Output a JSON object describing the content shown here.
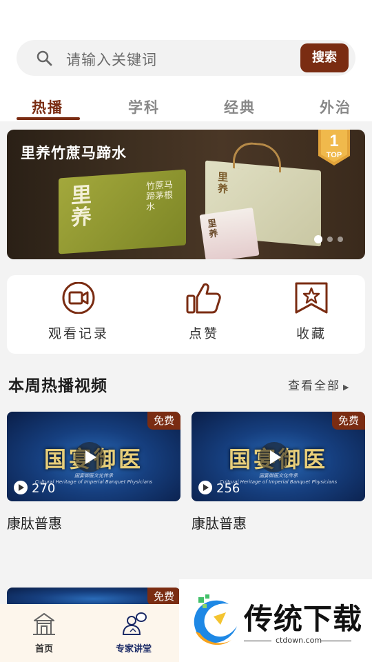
{
  "search": {
    "placeholder": "请输入关键词",
    "button": "搜索"
  },
  "tabs": [
    {
      "label": "热播",
      "active": true
    },
    {
      "label": "学科",
      "active": false
    },
    {
      "label": "经典",
      "active": false
    },
    {
      "label": "外治",
      "active": false
    }
  ],
  "banner": {
    "title": "里养竹蔗马蹄水",
    "box_big": "里养",
    "box_small": "竹蔗马蹄茅根水",
    "bag_label": "里养",
    "pouch_label": "里养",
    "badge_number": "1",
    "badge_text": "TOP",
    "dots": 3,
    "active_dot": 0
  },
  "quick_actions": [
    {
      "label": "观看记录",
      "icon": "video-history-icon"
    },
    {
      "label": "点赞",
      "icon": "thumbs-up-icon"
    },
    {
      "label": "收藏",
      "icon": "bookmark-star-icon"
    }
  ],
  "section": {
    "title": "本周热播视频",
    "more": "查看全部"
  },
  "videos": [
    {
      "thumb_title": "国宴御医",
      "sub1": "国宴御医文化传承",
      "sub2": "Cultural Heritage of Imperial Banquet Physicians",
      "badge": "免费",
      "views": "270",
      "title": "康肽普惠"
    },
    {
      "thumb_title": "国宴御医",
      "sub1": "国宴御医文化传承",
      "sub2": "Cultural Heritage of Imperial Banquet Physicians",
      "badge": "免费",
      "views": "256",
      "title": "康肽普惠"
    },
    {
      "badge": "免费"
    }
  ],
  "bottom_nav": [
    {
      "label": "首页",
      "icon": "home-pavilion-icon",
      "active": false
    },
    {
      "label": "专家讲堂",
      "icon": "expert-lecture-icon",
      "active": true
    }
  ],
  "watermark": {
    "text": "传统下载",
    "url": "ctdown.com"
  },
  "colors": {
    "brand": "#7a2c12",
    "nav_active": "#1b2a66"
  }
}
